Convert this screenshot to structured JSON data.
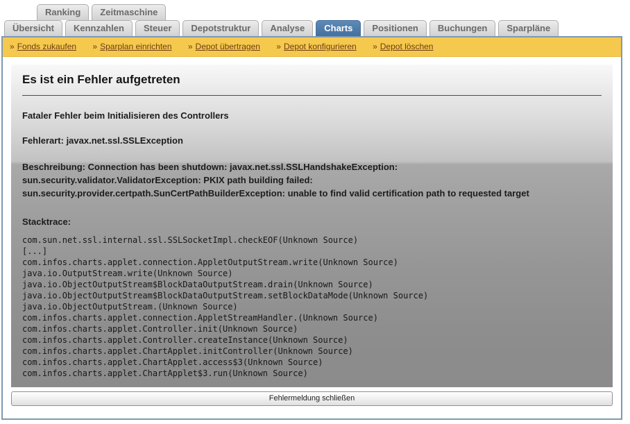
{
  "tab_rows": {
    "row1": [
      {
        "label": "Ranking"
      },
      {
        "label": "Zeitmaschine"
      }
    ],
    "row2": [
      {
        "label": "Übersicht"
      },
      {
        "label": "Kennzahlen"
      },
      {
        "label": "Steuer"
      },
      {
        "label": "Depotstruktur"
      },
      {
        "label": "Analyse"
      },
      {
        "label": "Charts",
        "active": true
      },
      {
        "label": "Positionen"
      },
      {
        "label": "Buchungen"
      },
      {
        "label": "Sparpläne"
      }
    ]
  },
  "action_bar": {
    "bullet": "»",
    "links": [
      {
        "label": "Fonds zukaufen"
      },
      {
        "label": "Sparplan einrichten"
      },
      {
        "label": "Depot übertragen"
      },
      {
        "label": "Depot konfigurieren"
      },
      {
        "label": "Depot löschen"
      }
    ]
  },
  "error_panel": {
    "title": "Es ist ein Fehler aufgetreten",
    "fatal_message": "Fataler Fehler beim Initialisieren des Controllers",
    "error_type": "Fehlerart: javax.net.ssl.SSLException",
    "description_lines": [
      "Beschreibung: Connection has been shutdown: javax.net.ssl.SSLHandshakeException:",
      "sun.security.validator.ValidatorException: PKIX path building failed:",
      "sun.security.provider.certpath.SunCertPathBuilderException: unable to find valid certification path to requested target"
    ],
    "stacktrace_label": "Stacktrace:",
    "stacktrace_lines": [
      "com.sun.net.ssl.internal.ssl.SSLSocketImpl.checkEOF(Unknown Source)",
      "[...]",
      "com.infos.charts.applet.connection.AppletOutputStream.write(Unknown Source)",
      "java.io.OutputStream.write(Unknown Source)",
      "java.io.ObjectOutputStream$BlockDataOutputStream.drain(Unknown Source)",
      "java.io.ObjectOutputStream$BlockDataOutputStream.setBlockDataMode(Unknown Source)",
      "java.io.ObjectOutputStream.(Unknown Source)",
      "com.infos.charts.applet.connection.AppletStreamHandler.(Unknown Source)",
      "com.infos.charts.applet.Controller.init(Unknown Source)",
      "com.infos.charts.applet.Controller.createInstance(Unknown Source)",
      "com.infos.charts.applet.ChartApplet.initController(Unknown Source)",
      "com.infos.charts.applet.ChartApplet.access$3(Unknown Source)",
      "com.infos.charts.applet.ChartApplet$3.run(Unknown Source)"
    ],
    "close_button_label": "Fehlermeldung schließen"
  },
  "colors": {
    "active_tab": "#4d7aad",
    "action_bar_bg": "#f5c94e",
    "link_text": "#6e3d12",
    "container_border": "#7e98b3"
  }
}
